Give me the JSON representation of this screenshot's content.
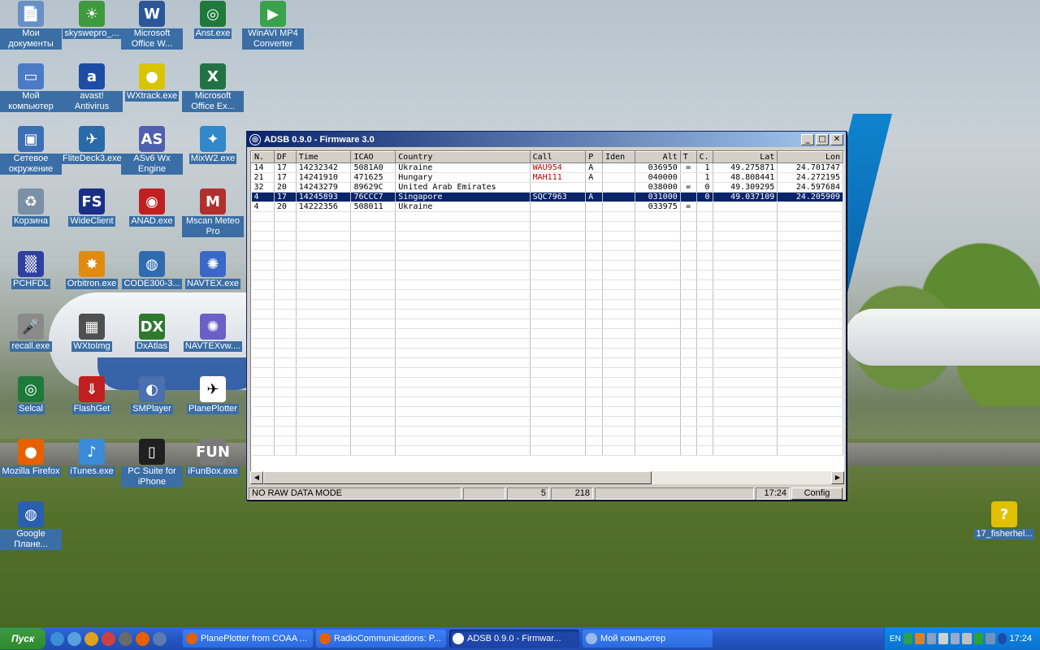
{
  "desktop_icons": [
    {
      "label": "Мои документы",
      "icon": "folder-docs-icon",
      "color": "#6a8fc4"
    },
    {
      "label": "skyswepro_...",
      "icon": "landscape-icon",
      "color": "#3d9a3d"
    },
    {
      "label": "Microsoft Office W...",
      "icon": "word-icon",
      "color": "#2b579a"
    },
    {
      "label": "Anst.exe",
      "icon": "radar-icon",
      "color": "#1d7a3a"
    },
    {
      "label": "WinAVI MP4 Converter",
      "icon": "converter-icon",
      "color": "#3aa24d"
    },
    {
      "label": "Мой компьютер",
      "icon": "computer-icon",
      "color": "#4b7bc4"
    },
    {
      "label": "avast! Antivirus",
      "icon": "avast-icon",
      "color": "#1c4ca6"
    },
    {
      "label": "WXtrack.exe",
      "icon": "ball-icon",
      "color": "#d8c400"
    },
    {
      "label": "Microsoft Office Ex...",
      "icon": "excel-icon",
      "color": "#217346"
    },
    {
      "label": "Сетевое окружение",
      "icon": "network-icon",
      "color": "#3d6fb5"
    },
    {
      "label": "FliteDeck3.exe",
      "icon": "flitedeck-icon",
      "color": "#2a6aa8"
    },
    {
      "label": "ASv6 Wx Engine",
      "icon": "asv6-icon",
      "color": "#5060b0"
    },
    {
      "label": "MixW2.exe",
      "icon": "butterfly-icon",
      "color": "#3388cc"
    },
    {
      "label": "Корзина",
      "icon": "recycle-bin-icon",
      "color": "#7b8fa5"
    },
    {
      "label": "WideClient",
      "icon": "wide-fs-icon",
      "color": "#1a2f8a"
    },
    {
      "label": "ANAD.exe",
      "icon": "target-icon",
      "color": "#c02020"
    },
    {
      "label": "Mscan Meteo Pro",
      "icon": "mscan-icon",
      "color": "#b03030"
    },
    {
      "label": "PCHFDL",
      "icon": "noise-icon",
      "color": "#3040a0"
    },
    {
      "label": "Orbitron.exe",
      "icon": "orbitron-icon",
      "color": "#e08a10"
    },
    {
      "label": "CODE300-3...",
      "icon": "globe-icon",
      "color": "#2f6bb0"
    },
    {
      "label": "NAVTEX.exe",
      "icon": "beacon-icon",
      "color": "#3a68c8"
    },
    {
      "label": "recall.exe",
      "icon": "microphone-icon",
      "color": "#8a8a8a"
    },
    {
      "label": "WXtoImg",
      "icon": "wxtoimg-icon",
      "color": "#505050"
    },
    {
      "label": "DxAtlas",
      "icon": "dxatlas-icon",
      "color": "#2d7a2d"
    },
    {
      "label": "NAVTEXvw....",
      "icon": "navtexvw-icon",
      "color": "#6a60c8"
    },
    {
      "label": "Selcal",
      "icon": "selcal-icon",
      "color": "#1d7a3a"
    },
    {
      "label": "FlashGet",
      "icon": "flashget-icon",
      "color": "#c02020"
    },
    {
      "label": "SMPlayer",
      "icon": "smplayer-icon",
      "color": "#4a70b0"
    },
    {
      "label": "PlanePlotter",
      "icon": "airplane-icon",
      "color": "#ffffff"
    },
    {
      "label": "Mozilla Firefox",
      "icon": "firefox-icon",
      "color": "#e66000"
    },
    {
      "label": "iTunes.exe",
      "icon": "itunes-icon",
      "color": "#3a8bd8"
    },
    {
      "label": "PC Suite for iPhone",
      "icon": "iphone-icon",
      "color": "#202020"
    },
    {
      "label": "iFunBox.exe",
      "icon": "ifunbox-icon",
      "color": "#7a7a7a"
    },
    {
      "label": "Google Плане...",
      "icon": "google-earth-icon",
      "color": "#2a5fb0"
    },
    {
      "label": "17_fisherhel...",
      "icon": "help-file-icon",
      "color": "#e0c000"
    }
  ],
  "window": {
    "title": "ADSB 0.9.0 - Firmware 3.0",
    "columns": [
      "N.",
      "DF",
      "Time",
      "ICAO",
      "Country",
      "Call",
      "P",
      "Iden",
      "Alt",
      "T",
      "C.",
      "Lat",
      "Lon"
    ],
    "rows": [
      {
        "n": "14",
        "df": "17",
        "time": "14232342",
        "icao": "5081A0",
        "country": "Ukraine",
        "call": "WAU954",
        "p": "A",
        "iden": "",
        "alt": "036950",
        "t": "=",
        "c": "1",
        "lat": "49.275871",
        "lon": "24.701747",
        "selected": false
      },
      {
        "n": "21",
        "df": "17",
        "time": "14241910",
        "icao": "471625",
        "country": "Hungary",
        "call": "MAH111",
        "p": "A",
        "iden": "",
        "alt": "040000",
        "t": "",
        "c": "1",
        "lat": "48.808441",
        "lon": "24.272195",
        "selected": false
      },
      {
        "n": "32",
        "df": "20",
        "time": "14243279",
        "icao": "89629C",
        "country": "United Arab Emirates",
        "call": "",
        "p": "",
        "iden": "",
        "alt": "038000",
        "t": "=",
        "c": "0",
        "lat": "49.309295",
        "lon": "24.597684",
        "selected": false
      },
      {
        "n": "4",
        "df": "17",
        "time": "14245893",
        "icao": "76CCC7",
        "country": "Singapore",
        "call": "SQC7963",
        "p": "A",
        "iden": "",
        "alt": "031000",
        "t": "",
        "c": "0",
        "lat": "49.037109",
        "lon": "24.205909",
        "selected": true
      },
      {
        "n": "4",
        "df": "20",
        "time": "14222356",
        "icao": "508011",
        "country": "Ukraine",
        "call": "",
        "p": "",
        "iden": "",
        "alt": "033975",
        "t": "=",
        "c": "",
        "lat": "",
        "lon": "",
        "selected": false
      }
    ],
    "status": {
      "mode": "NO RAW DATA MODE",
      "blank": "",
      "count": "5",
      "value": "218",
      "blank2": "",
      "time": "17:24",
      "config_label": "Config"
    }
  },
  "taskbar": {
    "start_label": "Пуск",
    "tasks": [
      {
        "label": "PlanePlotter from COAA ...",
        "active": false,
        "icon_color": "#e66000"
      },
      {
        "label": "RadioCommunications: P...",
        "active": false,
        "icon_color": "#e66000"
      },
      {
        "label": "ADSB 0.9.0 - Firmwar...",
        "active": true,
        "icon_color": "#ffffff"
      },
      {
        "label": "Мой компьютер",
        "active": false,
        "icon_color": "#9ab9e8"
      }
    ],
    "tray": {
      "lang": "EN",
      "clock": "17:24"
    }
  }
}
